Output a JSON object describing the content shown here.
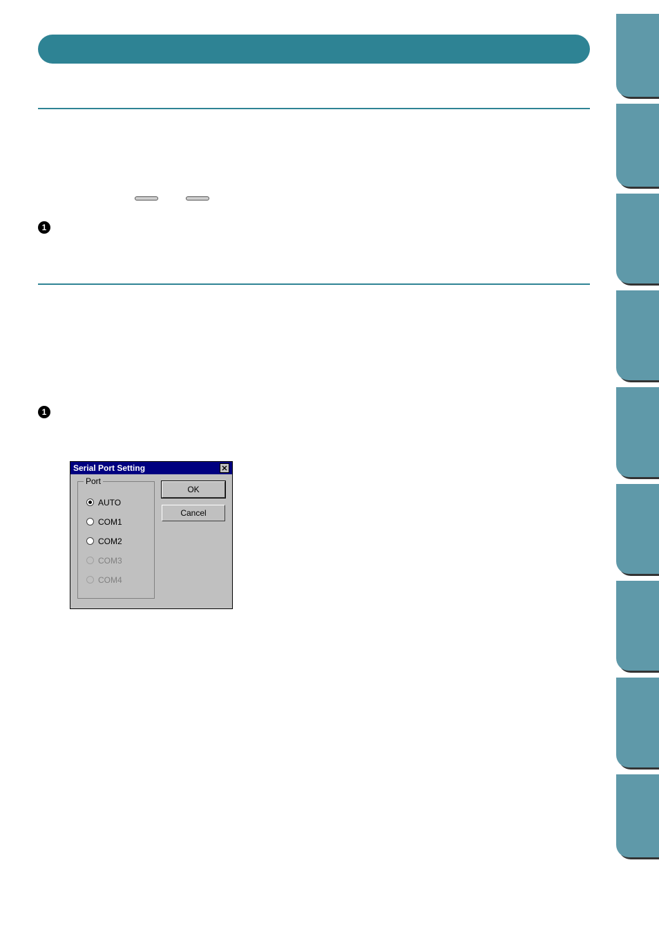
{
  "side_tabs": {
    "count": 9,
    "heights": [
      120,
      120,
      130,
      130,
      130,
      130,
      130,
      130,
      120
    ]
  },
  "title_bar": "",
  "section1": {
    "heading": "",
    "intro": "",
    "note": "",
    "key1": "",
    "key2": "",
    "between": "",
    "after": "",
    "step1_text": "",
    "para1": ""
  },
  "section2": {
    "heading": "",
    "intro": "",
    "note1": "",
    "note2": "",
    "step1_text": "",
    "para1": ""
  },
  "dialog": {
    "title": "Serial Port Setting",
    "group_label": "Port",
    "options": [
      {
        "label": "AUTO",
        "selected": true,
        "enabled": true
      },
      {
        "label": "COM1",
        "selected": false,
        "enabled": true
      },
      {
        "label": "COM2",
        "selected": false,
        "enabled": true
      },
      {
        "label": "COM3",
        "selected": false,
        "enabled": false
      },
      {
        "label": "COM4",
        "selected": false,
        "enabled": false
      }
    ],
    "ok": "OK",
    "cancel": "Cancel"
  }
}
